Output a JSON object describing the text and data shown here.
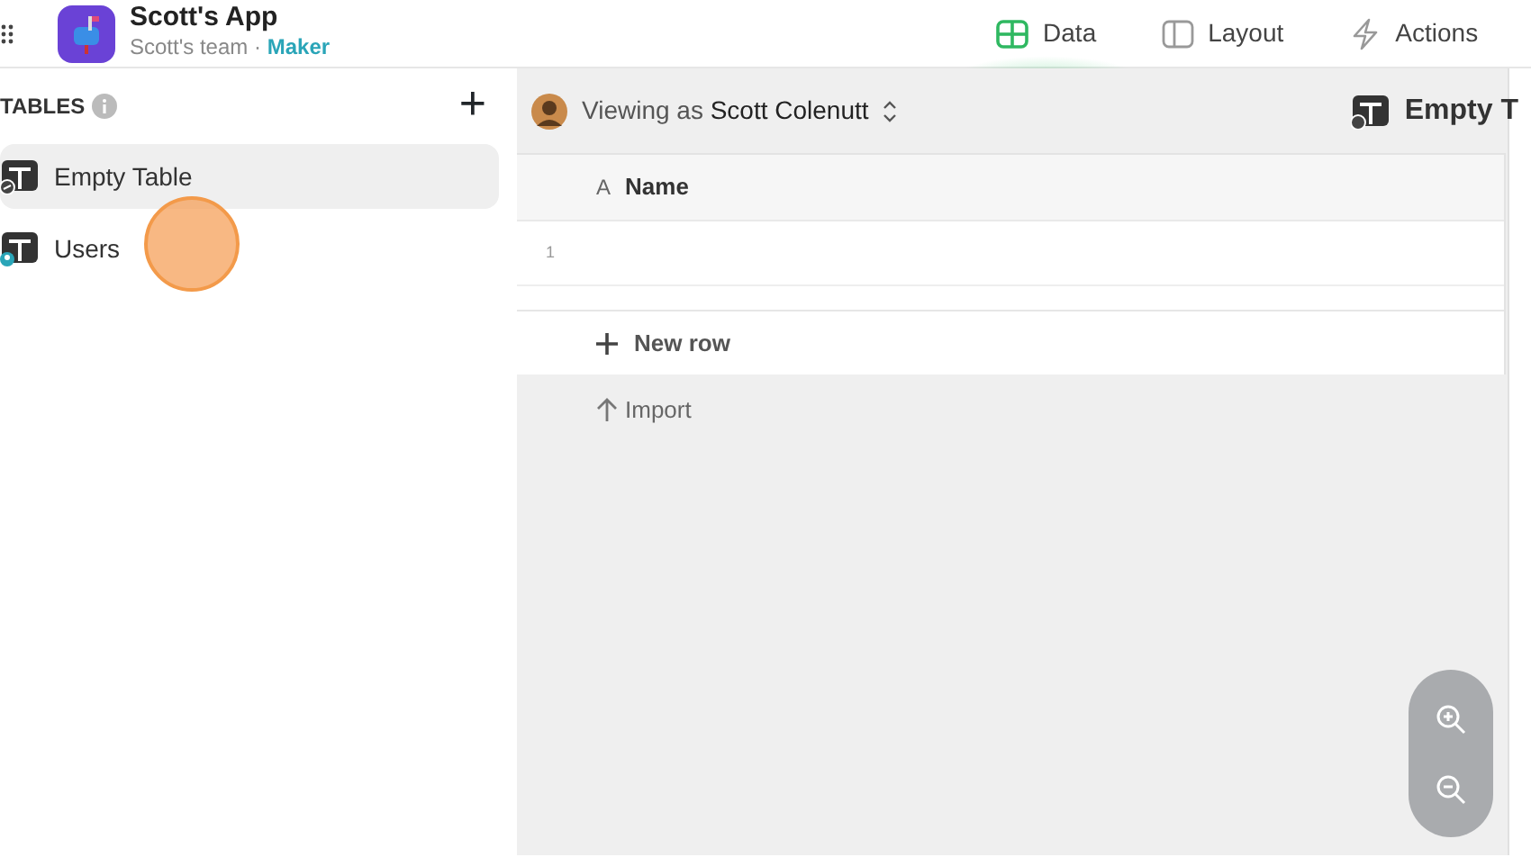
{
  "app": {
    "name": "Scott's App",
    "team": "Scott's team",
    "separator": "·",
    "role": "Maker"
  },
  "tabs": [
    {
      "label": "Data",
      "selected": true,
      "kind": "grid"
    },
    {
      "label": "Layout",
      "selected": false,
      "kind": "layout"
    },
    {
      "label": "Actions",
      "selected": false,
      "kind": "bolt"
    }
  ],
  "sidebar": {
    "heading": "TABLES",
    "add": "+",
    "items": [
      {
        "label": "Empty Table",
        "selected": true,
        "kind": "table"
      },
      {
        "label": "Users",
        "selected": false,
        "kind": "users"
      }
    ]
  },
  "toolbar": {
    "viewing_prefix": "Viewing as",
    "viewing_user": "Scott Colenutt",
    "table_title": "Empty T"
  },
  "grid": {
    "column_type": "A",
    "columns": [
      "Name"
    ],
    "rows": [
      {
        "number": "1"
      }
    ],
    "new_row": "New row",
    "import": "Import"
  }
}
